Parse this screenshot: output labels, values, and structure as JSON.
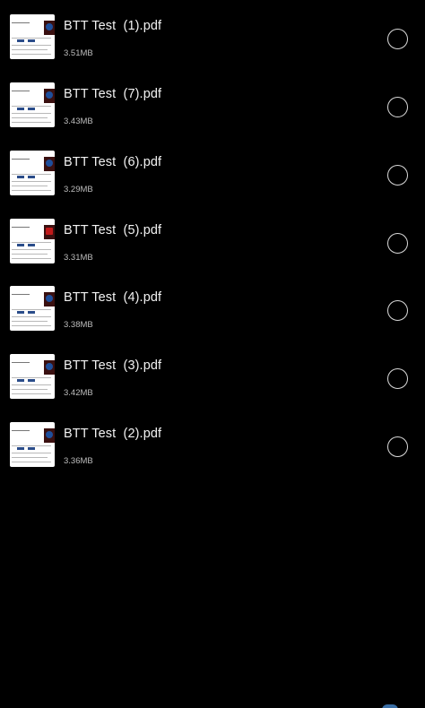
{
  "files": [
    {
      "name": "BTT Test  (1).pdf",
      "size": "3.51MB",
      "sign": "blue"
    },
    {
      "name": "BTT Test  (7).pdf",
      "size": "3.43MB",
      "sign": "blue"
    },
    {
      "name": "BTT Test  (6).pdf",
      "size": "3.29MB",
      "sign": "blue"
    },
    {
      "name": "BTT Test  (5).pdf",
      "size": "3.31MB",
      "sign": "red"
    },
    {
      "name": "BTT Test  (4).pdf",
      "size": "3.38MB",
      "sign": "blue"
    },
    {
      "name": "BTT Test  (3).pdf",
      "size": "3.42MB",
      "sign": "blue"
    },
    {
      "name": "BTT Test  (2).pdf",
      "size": "3.36MB",
      "sign": "blue"
    }
  ],
  "icons": {
    "thumbnail": "pdf-thumbnail-icon",
    "select": "radio-unchecked-icon"
  }
}
